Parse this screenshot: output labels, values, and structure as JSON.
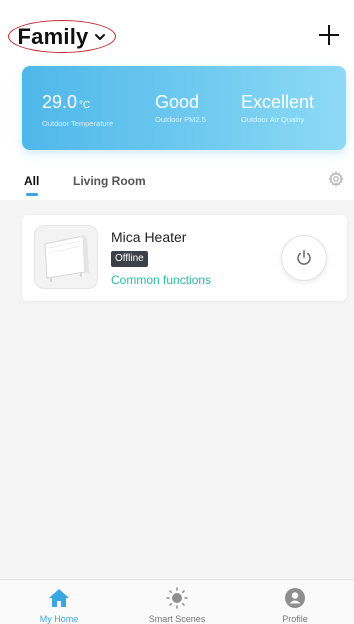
{
  "header": {
    "family_label": "Family",
    "plus_icon": "plus-icon",
    "chevron_icon": "chevron-down-icon"
  },
  "weather": {
    "temperature": {
      "value": "29.0",
      "unit": "°C",
      "label": "Outdoor Temperature"
    },
    "pm25": {
      "value": "Good",
      "label": "Outdoor PM2.5"
    },
    "air_quality": {
      "value": "Excellent",
      "label": "Outdoor Air Quality"
    },
    "gradient_colors": [
      "#4fb8e9",
      "#8ddaf5"
    ]
  },
  "tabs": {
    "items": [
      {
        "label": "All",
        "active": true
      },
      {
        "label": "Living Room",
        "active": false
      }
    ],
    "settings_icon": "gear-icon",
    "accent": "#3aa7e0"
  },
  "device": {
    "name": "Mica Heater",
    "status": "Offline",
    "action_link": "Common functions",
    "power_icon": "power-icon",
    "link_color": "#2db9a3"
  },
  "bottom_nav": {
    "items": [
      {
        "label": "My Home",
        "icon": "home-icon",
        "active": true
      },
      {
        "label": "Smart Scenes",
        "icon": "sun-icon",
        "active": false
      },
      {
        "label": "Profile",
        "icon": "profile-icon",
        "active": false
      }
    ]
  }
}
